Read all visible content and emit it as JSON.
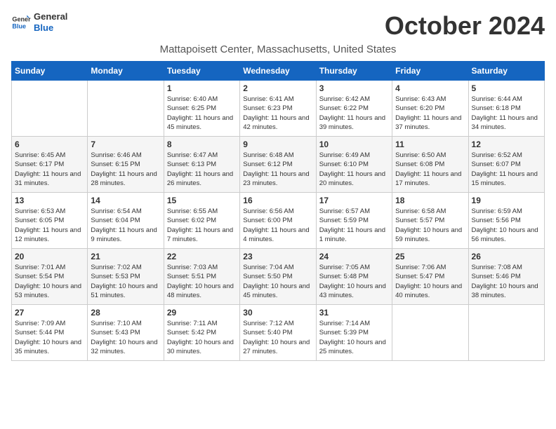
{
  "logo": {
    "line1": "General",
    "line2": "Blue"
  },
  "title": "October 2024",
  "location": "Mattapoisett Center, Massachusetts, United States",
  "weekdays": [
    "Sunday",
    "Monday",
    "Tuesday",
    "Wednesday",
    "Thursday",
    "Friday",
    "Saturday"
  ],
  "weeks": [
    [
      {
        "day": "",
        "info": ""
      },
      {
        "day": "",
        "info": ""
      },
      {
        "day": "1",
        "info": "Sunrise: 6:40 AM\nSunset: 6:25 PM\nDaylight: 11 hours and 45 minutes."
      },
      {
        "day": "2",
        "info": "Sunrise: 6:41 AM\nSunset: 6:23 PM\nDaylight: 11 hours and 42 minutes."
      },
      {
        "day": "3",
        "info": "Sunrise: 6:42 AM\nSunset: 6:22 PM\nDaylight: 11 hours and 39 minutes."
      },
      {
        "day": "4",
        "info": "Sunrise: 6:43 AM\nSunset: 6:20 PM\nDaylight: 11 hours and 37 minutes."
      },
      {
        "day": "5",
        "info": "Sunrise: 6:44 AM\nSunset: 6:18 PM\nDaylight: 11 hours and 34 minutes."
      }
    ],
    [
      {
        "day": "6",
        "info": "Sunrise: 6:45 AM\nSunset: 6:17 PM\nDaylight: 11 hours and 31 minutes."
      },
      {
        "day": "7",
        "info": "Sunrise: 6:46 AM\nSunset: 6:15 PM\nDaylight: 11 hours and 28 minutes."
      },
      {
        "day": "8",
        "info": "Sunrise: 6:47 AM\nSunset: 6:13 PM\nDaylight: 11 hours and 26 minutes."
      },
      {
        "day": "9",
        "info": "Sunrise: 6:48 AM\nSunset: 6:12 PM\nDaylight: 11 hours and 23 minutes."
      },
      {
        "day": "10",
        "info": "Sunrise: 6:49 AM\nSunset: 6:10 PM\nDaylight: 11 hours and 20 minutes."
      },
      {
        "day": "11",
        "info": "Sunrise: 6:50 AM\nSunset: 6:08 PM\nDaylight: 11 hours and 17 minutes."
      },
      {
        "day": "12",
        "info": "Sunrise: 6:52 AM\nSunset: 6:07 PM\nDaylight: 11 hours and 15 minutes."
      }
    ],
    [
      {
        "day": "13",
        "info": "Sunrise: 6:53 AM\nSunset: 6:05 PM\nDaylight: 11 hours and 12 minutes."
      },
      {
        "day": "14",
        "info": "Sunrise: 6:54 AM\nSunset: 6:04 PM\nDaylight: 11 hours and 9 minutes."
      },
      {
        "day": "15",
        "info": "Sunrise: 6:55 AM\nSunset: 6:02 PM\nDaylight: 11 hours and 7 minutes."
      },
      {
        "day": "16",
        "info": "Sunrise: 6:56 AM\nSunset: 6:00 PM\nDaylight: 11 hours and 4 minutes."
      },
      {
        "day": "17",
        "info": "Sunrise: 6:57 AM\nSunset: 5:59 PM\nDaylight: 11 hours and 1 minute."
      },
      {
        "day": "18",
        "info": "Sunrise: 6:58 AM\nSunset: 5:57 PM\nDaylight: 10 hours and 59 minutes."
      },
      {
        "day": "19",
        "info": "Sunrise: 6:59 AM\nSunset: 5:56 PM\nDaylight: 10 hours and 56 minutes."
      }
    ],
    [
      {
        "day": "20",
        "info": "Sunrise: 7:01 AM\nSunset: 5:54 PM\nDaylight: 10 hours and 53 minutes."
      },
      {
        "day": "21",
        "info": "Sunrise: 7:02 AM\nSunset: 5:53 PM\nDaylight: 10 hours and 51 minutes."
      },
      {
        "day": "22",
        "info": "Sunrise: 7:03 AM\nSunset: 5:51 PM\nDaylight: 10 hours and 48 minutes."
      },
      {
        "day": "23",
        "info": "Sunrise: 7:04 AM\nSunset: 5:50 PM\nDaylight: 10 hours and 45 minutes."
      },
      {
        "day": "24",
        "info": "Sunrise: 7:05 AM\nSunset: 5:48 PM\nDaylight: 10 hours and 43 minutes."
      },
      {
        "day": "25",
        "info": "Sunrise: 7:06 AM\nSunset: 5:47 PM\nDaylight: 10 hours and 40 minutes."
      },
      {
        "day": "26",
        "info": "Sunrise: 7:08 AM\nSunset: 5:46 PM\nDaylight: 10 hours and 38 minutes."
      }
    ],
    [
      {
        "day": "27",
        "info": "Sunrise: 7:09 AM\nSunset: 5:44 PM\nDaylight: 10 hours and 35 minutes."
      },
      {
        "day": "28",
        "info": "Sunrise: 7:10 AM\nSunset: 5:43 PM\nDaylight: 10 hours and 32 minutes."
      },
      {
        "day": "29",
        "info": "Sunrise: 7:11 AM\nSunset: 5:42 PM\nDaylight: 10 hours and 30 minutes."
      },
      {
        "day": "30",
        "info": "Sunrise: 7:12 AM\nSunset: 5:40 PM\nDaylight: 10 hours and 27 minutes."
      },
      {
        "day": "31",
        "info": "Sunrise: 7:14 AM\nSunset: 5:39 PM\nDaylight: 10 hours and 25 minutes."
      },
      {
        "day": "",
        "info": ""
      },
      {
        "day": "",
        "info": ""
      }
    ]
  ]
}
